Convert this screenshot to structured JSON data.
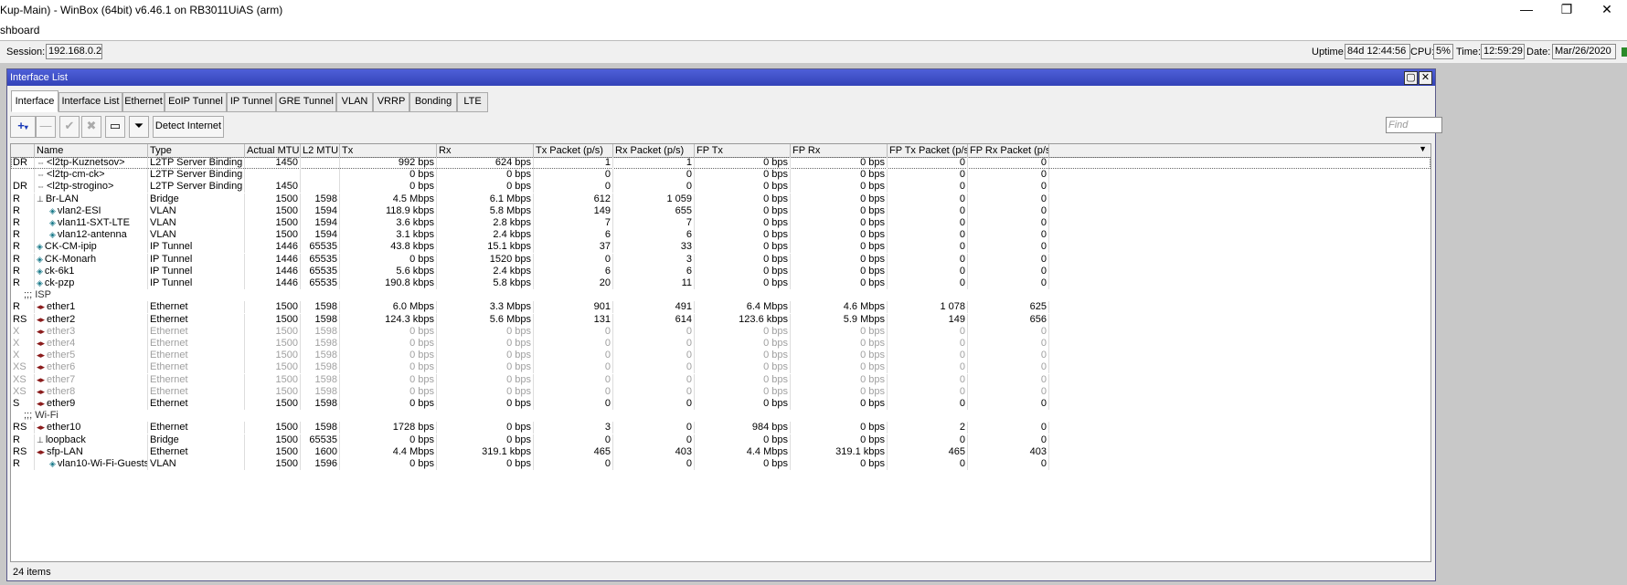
{
  "app": {
    "title": "Kup-Main) - WinBox (64bit) v6.46.1 on RB3011UiAS (arm)",
    "menu_partial": "shboard",
    "controls": {
      "minimize": "—",
      "maximize": "❐",
      "close": "✕"
    }
  },
  "session": {
    "session_label": "Session:",
    "session_value": "192.168.0.2",
    "uptime_label": "Uptime:",
    "uptime_value": "84d 12:44:56",
    "cpu_label": "CPU:",
    "cpu_value": "5%",
    "time_label": "Time:",
    "time_value": "12:59:29",
    "date_label": "Date:",
    "date_value": "Mar/26/2020"
  },
  "window": {
    "title": "Interface List",
    "tabs": [
      "Interface",
      "Interface List",
      "Ethernet",
      "EoIP Tunnel",
      "IP Tunnel",
      "GRE Tunnel",
      "VLAN",
      "VRRP",
      "Bonding",
      "LTE"
    ],
    "active_tab": "Interface",
    "toolbar": {
      "detect_label": "Detect Internet",
      "find_placeholder": "Find"
    },
    "columns": [
      "Name",
      "Type",
      "Actual MTU",
      "L2 MTU",
      "Tx",
      "Rx",
      "Tx Packet (p/s)",
      "Rx Packet (p/s)",
      "FP Tx",
      "FP Rx",
      "FP Tx Packet (p/s)",
      "FP Rx Packet (p/s)"
    ],
    "status": "24 items"
  },
  "rows": [
    {
      "flag": "DR",
      "icon": "l2tp-icon",
      "indent": 0,
      "name": "<l2tp-Kuznetsov>",
      "type": "L2TP Server Binding",
      "mtu": "1450",
      "l2mtu": "",
      "tx": "992 bps",
      "rx": "624 bps",
      "txp": "1",
      "rxp": "1",
      "fptx": "0 bps",
      "fprx": "0 bps",
      "fptxp": "0",
      "fprxp": "0",
      "selected": true
    },
    {
      "flag": "",
      "icon": "l2tp-icon",
      "indent": 0,
      "name": "<l2tp-cm-ck>",
      "type": "L2TP Server Binding",
      "mtu": "",
      "l2mtu": "",
      "tx": "0 bps",
      "rx": "0 bps",
      "txp": "0",
      "rxp": "0",
      "fptx": "0 bps",
      "fprx": "0 bps",
      "fptxp": "0",
      "fprxp": "0"
    },
    {
      "flag": "DR",
      "icon": "l2tp-icon",
      "indent": 0,
      "name": "<l2tp-strogino>",
      "type": "L2TP Server Binding",
      "mtu": "1450",
      "l2mtu": "",
      "tx": "0 bps",
      "rx": "0 bps",
      "txp": "0",
      "rxp": "0",
      "fptx": "0 bps",
      "fprx": "0 bps",
      "fptxp": "0",
      "fprxp": "0"
    },
    {
      "flag": "R",
      "icon": "bridge-icon",
      "indent": 0,
      "name": "Br-LAN",
      "type": "Bridge",
      "mtu": "1500",
      "l2mtu": "1598",
      "tx": "4.5 Mbps",
      "rx": "6.1 Mbps",
      "txp": "612",
      "rxp": "1 059",
      "fptx": "0 bps",
      "fprx": "0 bps",
      "fptxp": "0",
      "fprxp": "0"
    },
    {
      "flag": "R",
      "icon": "vlan-icon",
      "indent": 1,
      "name": "vlan2-ESI",
      "type": "VLAN",
      "mtu": "1500",
      "l2mtu": "1594",
      "tx": "118.9 kbps",
      "rx": "5.8 Mbps",
      "txp": "149",
      "rxp": "655",
      "fptx": "0 bps",
      "fprx": "0 bps",
      "fptxp": "0",
      "fprxp": "0"
    },
    {
      "flag": "R",
      "icon": "vlan-icon",
      "indent": 1,
      "name": "vlan11-SXT-LTE",
      "type": "VLAN",
      "mtu": "1500",
      "l2mtu": "1594",
      "tx": "3.6 kbps",
      "rx": "2.8 kbps",
      "txp": "7",
      "rxp": "7",
      "fptx": "0 bps",
      "fprx": "0 bps",
      "fptxp": "0",
      "fprxp": "0"
    },
    {
      "flag": "R",
      "icon": "vlan-icon",
      "indent": 1,
      "name": "vlan12-antenna",
      "type": "VLAN",
      "mtu": "1500",
      "l2mtu": "1594",
      "tx": "3.1 kbps",
      "rx": "2.4 kbps",
      "txp": "6",
      "rxp": "6",
      "fptx": "0 bps",
      "fprx": "0 bps",
      "fptxp": "0",
      "fprxp": "0"
    },
    {
      "flag": "R",
      "icon": "tunnel-icon",
      "indent": 0,
      "name": "CK-CM-ipip",
      "type": "IP Tunnel",
      "mtu": "1446",
      "l2mtu": "65535",
      "tx": "43.8 kbps",
      "rx": "15.1 kbps",
      "txp": "37",
      "rxp": "33",
      "fptx": "0 bps",
      "fprx": "0 bps",
      "fptxp": "0",
      "fprxp": "0"
    },
    {
      "flag": "R",
      "icon": "tunnel-icon",
      "indent": 0,
      "name": "CK-Monarh",
      "type": "IP Tunnel",
      "mtu": "1446",
      "l2mtu": "65535",
      "tx": "0 bps",
      "rx": "1520 bps",
      "txp": "0",
      "rxp": "3",
      "fptx": "0 bps",
      "fprx": "0 bps",
      "fptxp": "0",
      "fprxp": "0"
    },
    {
      "flag": "R",
      "icon": "tunnel-icon",
      "indent": 0,
      "name": "ck-6k1",
      "type": "IP Tunnel",
      "mtu": "1446",
      "l2mtu": "65535",
      "tx": "5.6 kbps",
      "rx": "2.4 kbps",
      "txp": "6",
      "rxp": "6",
      "fptx": "0 bps",
      "fprx": "0 bps",
      "fptxp": "0",
      "fprxp": "0"
    },
    {
      "flag": "R",
      "icon": "tunnel-icon",
      "indent": 0,
      "name": "ck-pzp",
      "type": "IP Tunnel",
      "mtu": "1446",
      "l2mtu": "65535",
      "tx": "190.8 kbps",
      "rx": "5.8 kbps",
      "txp": "20",
      "rxp": "11",
      "fptx": "0 bps",
      "fprx": "0 bps",
      "fptxp": "0",
      "fprxp": "0"
    },
    {
      "comment": ";;; ISP"
    },
    {
      "flag": "R",
      "icon": "ethernet-icon",
      "indent": 0,
      "name": "ether1",
      "type": "Ethernet",
      "mtu": "1500",
      "l2mtu": "1598",
      "tx": "6.0 Mbps",
      "rx": "3.3 Mbps",
      "txp": "901",
      "rxp": "491",
      "fptx": "6.4 Mbps",
      "fprx": "4.6 Mbps",
      "fptxp": "1 078",
      "fprxp": "625"
    },
    {
      "flag": "RS",
      "icon": "ethernet-icon",
      "indent": 0,
      "name": "ether2",
      "type": "Ethernet",
      "mtu": "1500",
      "l2mtu": "1598",
      "tx": "124.3 kbps",
      "rx": "5.6 Mbps",
      "txp": "131",
      "rxp": "614",
      "fptx": "123.6 kbps",
      "fprx": "5.9 Mbps",
      "fptxp": "149",
      "fprxp": "656"
    },
    {
      "flag": "X",
      "icon": "ethernet-icon",
      "indent": 0,
      "name": "ether3",
      "type": "Ethernet",
      "mtu": "1500",
      "l2mtu": "1598",
      "tx": "0 bps",
      "rx": "0 bps",
      "txp": "0",
      "rxp": "0",
      "fptx": "0 bps",
      "fprx": "0 bps",
      "fptxp": "0",
      "fprxp": "0",
      "disabled": true
    },
    {
      "flag": "X",
      "icon": "ethernet-icon",
      "indent": 0,
      "name": "ether4",
      "type": "Ethernet",
      "mtu": "1500",
      "l2mtu": "1598",
      "tx": "0 bps",
      "rx": "0 bps",
      "txp": "0",
      "rxp": "0",
      "fptx": "0 bps",
      "fprx": "0 bps",
      "fptxp": "0",
      "fprxp": "0",
      "disabled": true
    },
    {
      "flag": "X",
      "icon": "ethernet-icon",
      "indent": 0,
      "name": "ether5",
      "type": "Ethernet",
      "mtu": "1500",
      "l2mtu": "1598",
      "tx": "0 bps",
      "rx": "0 bps",
      "txp": "0",
      "rxp": "0",
      "fptx": "0 bps",
      "fprx": "0 bps",
      "fptxp": "0",
      "fprxp": "0",
      "disabled": true
    },
    {
      "flag": "XS",
      "icon": "ethernet-icon",
      "indent": 0,
      "name": "ether6",
      "type": "Ethernet",
      "mtu": "1500",
      "l2mtu": "1598",
      "tx": "0 bps",
      "rx": "0 bps",
      "txp": "0",
      "rxp": "0",
      "fptx": "0 bps",
      "fprx": "0 bps",
      "fptxp": "0",
      "fprxp": "0",
      "disabled": true
    },
    {
      "flag": "XS",
      "icon": "ethernet-icon",
      "indent": 0,
      "name": "ether7",
      "type": "Ethernet",
      "mtu": "1500",
      "l2mtu": "1598",
      "tx": "0 bps",
      "rx": "0 bps",
      "txp": "0",
      "rxp": "0",
      "fptx": "0 bps",
      "fprx": "0 bps",
      "fptxp": "0",
      "fprxp": "0",
      "disabled": true
    },
    {
      "flag": "XS",
      "icon": "ethernet-icon",
      "indent": 0,
      "name": "ether8",
      "type": "Ethernet",
      "mtu": "1500",
      "l2mtu": "1598",
      "tx": "0 bps",
      "rx": "0 bps",
      "txp": "0",
      "rxp": "0",
      "fptx": "0 bps",
      "fprx": "0 bps",
      "fptxp": "0",
      "fprxp": "0",
      "disabled": true
    },
    {
      "flag": "S",
      "icon": "ethernet-icon",
      "indent": 0,
      "name": "ether9",
      "type": "Ethernet",
      "mtu": "1500",
      "l2mtu": "1598",
      "tx": "0 bps",
      "rx": "0 bps",
      "txp": "0",
      "rxp": "0",
      "fptx": "0 bps",
      "fprx": "0 bps",
      "fptxp": "0",
      "fprxp": "0"
    },
    {
      "comment": ";;; Wi-Fi"
    },
    {
      "flag": "RS",
      "icon": "ethernet-icon",
      "indent": 0,
      "name": "ether10",
      "type": "Ethernet",
      "mtu": "1500",
      "l2mtu": "1598",
      "tx": "1728 bps",
      "rx": "0 bps",
      "txp": "3",
      "rxp": "0",
      "fptx": "984 bps",
      "fprx": "0 bps",
      "fptxp": "2",
      "fprxp": "0"
    },
    {
      "flag": "R",
      "icon": "bridge-icon",
      "indent": 0,
      "name": "loopback",
      "type": "Bridge",
      "mtu": "1500",
      "l2mtu": "65535",
      "tx": "0 bps",
      "rx": "0 bps",
      "txp": "0",
      "rxp": "0",
      "fptx": "0 bps",
      "fprx": "0 bps",
      "fptxp": "0",
      "fprxp": "0"
    },
    {
      "flag": "RS",
      "icon": "ethernet-icon",
      "indent": 0,
      "name": "sfp-LAN",
      "type": "Ethernet",
      "mtu": "1500",
      "l2mtu": "1600",
      "tx": "4.4 Mbps",
      "rx": "319.1 kbps",
      "txp": "465",
      "rxp": "403",
      "fptx": "4.4 Mbps",
      "fprx": "319.1 kbps",
      "fptxp": "465",
      "fprxp": "403"
    },
    {
      "flag": "R",
      "icon": "vlan-icon",
      "indent": 1,
      "name": "vlan10-Wi-Fi-Guests",
      "type": "VLAN",
      "mtu": "1500",
      "l2mtu": "1596",
      "tx": "0 bps",
      "rx": "0 bps",
      "txp": "0",
      "rxp": "0",
      "fptx": "0 bps",
      "fprx": "0 bps",
      "fptxp": "0",
      "fprxp": "0"
    }
  ]
}
